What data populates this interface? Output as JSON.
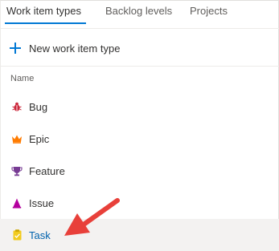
{
  "tabs": [
    {
      "label": "Work item types",
      "active": true
    },
    {
      "label": "Backlog levels",
      "active": false
    },
    {
      "label": "Projects",
      "active": false
    }
  ],
  "toolbar": {
    "new_label": "New work item type",
    "new_icon": "plus-icon"
  },
  "list": {
    "column_header": "Name",
    "items": [
      {
        "label": "Bug",
        "icon": "bug-icon",
        "color": "#cc293d"
      },
      {
        "label": "Epic",
        "icon": "crown-icon",
        "color": "#ff7b00"
      },
      {
        "label": "Feature",
        "icon": "trophy-icon",
        "color": "#773b93"
      },
      {
        "label": "Issue",
        "icon": "issue-icon",
        "color": "#b4009e"
      },
      {
        "label": "Task",
        "icon": "clipboard-icon",
        "color": "#f2cb1d",
        "selected": true
      }
    ]
  },
  "annotation": {
    "type": "arrow",
    "color": "#e8403a",
    "points_to": "Task"
  },
  "colors": {
    "accent": "#0078d4",
    "selected_row": "#f3f2f1"
  }
}
